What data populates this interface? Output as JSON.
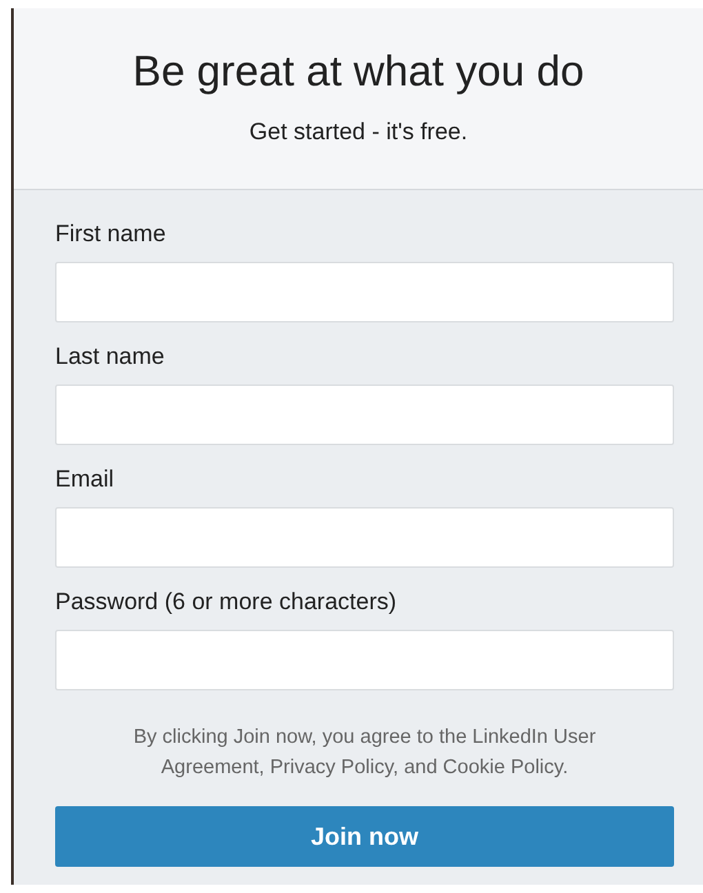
{
  "header": {
    "title": "Be great at what you do",
    "subtitle": "Get started - it's free."
  },
  "fields": [
    {
      "label": "First name"
    },
    {
      "label": "Last name"
    },
    {
      "label": "Email"
    },
    {
      "label": "Password (6 or more characters)"
    }
  ],
  "terms": "By clicking Join now, you agree to the LinkedIn User Agreement, Privacy Policy, and Cookie Policy.",
  "submit": "Join now"
}
